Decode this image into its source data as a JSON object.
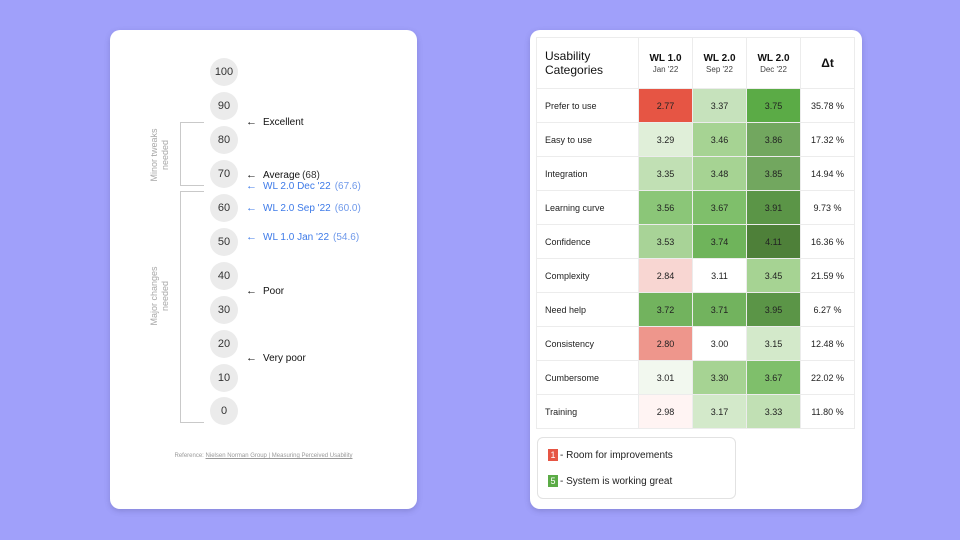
{
  "scale": {
    "ticks": [
      "100",
      "90",
      "80",
      "70",
      "60",
      "50",
      "40",
      "30",
      "20",
      "10",
      "0"
    ],
    "brackets": [
      {
        "label_line1": "Minor tweaks",
        "label_line2": "needed"
      },
      {
        "label_line1": "Major changes",
        "label_line2": "needed"
      }
    ],
    "markers": [
      {
        "label": "Excellent",
        "value": "",
        "style": "black"
      },
      {
        "label": "Average",
        "value": "(68)",
        "style": "black"
      },
      {
        "label": "WL 2.0 Dec '22",
        "value": "(67.6)",
        "style": "blue"
      },
      {
        "label": "WL 2.0 Sep '22",
        "value": "(60.0)",
        "style": "blue"
      },
      {
        "label": "WL 1.0 Jan '22",
        "value": "(54.6)",
        "style": "blue"
      },
      {
        "label": "Poor",
        "value": "",
        "style": "black"
      },
      {
        "label": "Very poor",
        "value": "",
        "style": "black"
      }
    ],
    "arrow_symbol": "←",
    "reference_prefix": "Reference: ",
    "reference_link": "Nielsen Norman Group | Measuring Perceived Usability"
  },
  "table": {
    "header": {
      "category_line1": "Usability",
      "category_line2": "Categories",
      "columns": [
        {
          "title": "WL 1.0",
          "sub": "Jan '22"
        },
        {
          "title": "WL 2.0",
          "sub": "Sep '22"
        },
        {
          "title": "WL 2.0",
          "sub": "Dec '22"
        }
      ],
      "delta": "Δt"
    },
    "rows": [
      {
        "category": "Prefer to use",
        "values": [
          "2.77",
          "3.37",
          "3.75"
        ],
        "colors": [
          "#e65544",
          "#c6e2bc",
          "#5bab46"
        ],
        "delta": "35.78 %"
      },
      {
        "category": "Easy to use",
        "values": [
          "3.29",
          "3.46",
          "3.86"
        ],
        "colors": [
          "#e0efd9",
          "#a6d393",
          "#72a75f"
        ],
        "delta": "17.32 %"
      },
      {
        "category": "Integration",
        "values": [
          "3.35",
          "3.48",
          "3.85"
        ],
        "colors": [
          "#c1e0b4",
          "#a6d393",
          "#72a75f"
        ],
        "delta": "14.94 %"
      },
      {
        "category": "Learning curve",
        "values": [
          "3.56",
          "3.67",
          "3.91"
        ],
        "colors": [
          "#8bc678",
          "#7fbf6b",
          "#5b9547"
        ],
        "delta": "9.73 %"
      },
      {
        "category": "Confidence",
        "values": [
          "3.53",
          "3.74",
          "4.11"
        ],
        "colors": [
          "#a8d397",
          "#6fb45b",
          "#4e8039"
        ],
        "delta": "16.36 %"
      },
      {
        "category": "Complexity",
        "values": [
          "2.84",
          "3.11",
          "3.45"
        ],
        "colors": [
          "#f8d6d2",
          "#ffffff",
          "#a6d393"
        ],
        "delta": "21.59 %"
      },
      {
        "category": "Need help",
        "values": [
          "3.72",
          "3.71",
          "3.95"
        ],
        "colors": [
          "#72b35e",
          "#72b35e",
          "#5b9547"
        ],
        "delta": "6.27 %"
      },
      {
        "category": "Consistency",
        "values": [
          "2.80",
          "3.00",
          "3.15"
        ],
        "colors": [
          "#ee968c",
          "#ffffff",
          "#d3e9ca"
        ],
        "delta": "12.48 %"
      },
      {
        "category": "Cumbersome",
        "values": [
          "3.01",
          "3.30",
          "3.67"
        ],
        "colors": [
          "#f2f8ef",
          "#a6d393",
          "#7fbf6b"
        ],
        "delta": "22.02 %"
      },
      {
        "category": "Training",
        "values": [
          "2.98",
          "3.17",
          "3.33"
        ],
        "colors": [
          "#fff4f3",
          "#d3e9ca",
          "#c1e0b4"
        ],
        "delta": "11.80 %"
      }
    ]
  },
  "legend": [
    {
      "number": "1",
      "text": " - Room for improvements",
      "color": "#e65544"
    },
    {
      "number": "5",
      "text": " - System is working great",
      "color": "#5bab46"
    }
  ]
}
